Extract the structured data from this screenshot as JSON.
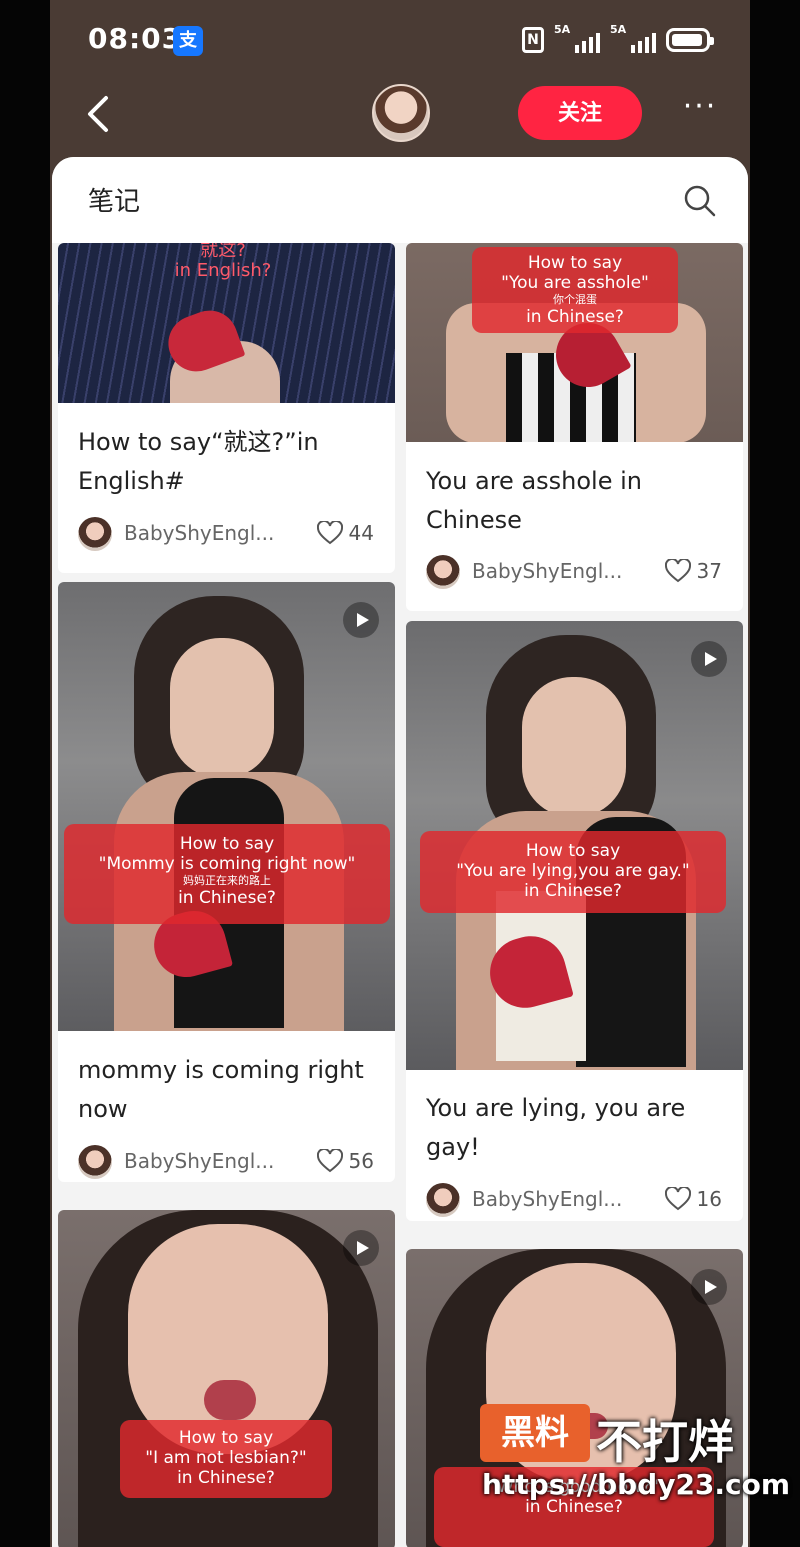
{
  "status": {
    "time": "08:03",
    "app_badge": "支",
    "nfc": "N",
    "signal1": "5A",
    "signal2": "5A"
  },
  "header": {
    "follow_label": "关注",
    "more_label": "···"
  },
  "sheet": {
    "title": "笔记"
  },
  "colors": {
    "accent": "#ff2442",
    "overlay": "#e0282d"
  },
  "cards": [
    {
      "overlay": [
        "就这?",
        "in English?"
      ],
      "title": "How to say“就这?”in English#",
      "author": "BabyShyEngl...",
      "likes": "44"
    },
    {
      "overlay": [
        "How to say",
        "\"You are asshole\"",
        "你个混蛋",
        "in Chinese?"
      ],
      "title": "You are asshole in Chinese",
      "author": "BabyShyEngl...",
      "likes": "37"
    },
    {
      "overlay": [
        "How to say",
        "\"Mommy is coming right now\"",
        "妈妈正在来的路上",
        "in Chinese?"
      ],
      "title": "mommy is coming right now",
      "author": "BabyShyEngl...",
      "likes": "56"
    },
    {
      "overlay": [
        "How to say",
        "\"You are lying,you are gay.\"",
        "in Chinese?"
      ],
      "title": "You are lying, you are gay!",
      "author": "BabyShyEngl...",
      "likes": "16"
    },
    {
      "overlay": [
        "How to say",
        "\"I am not lesbian?\"",
        "in Chinese?"
      ]
    },
    {
      "overlay": [
        "\"Who is good now?\"",
        "in Chinese?"
      ]
    }
  ],
  "watermark": {
    "badge": "黑料",
    "text": "不打烊",
    "url": "https://bbdy23.com"
  }
}
